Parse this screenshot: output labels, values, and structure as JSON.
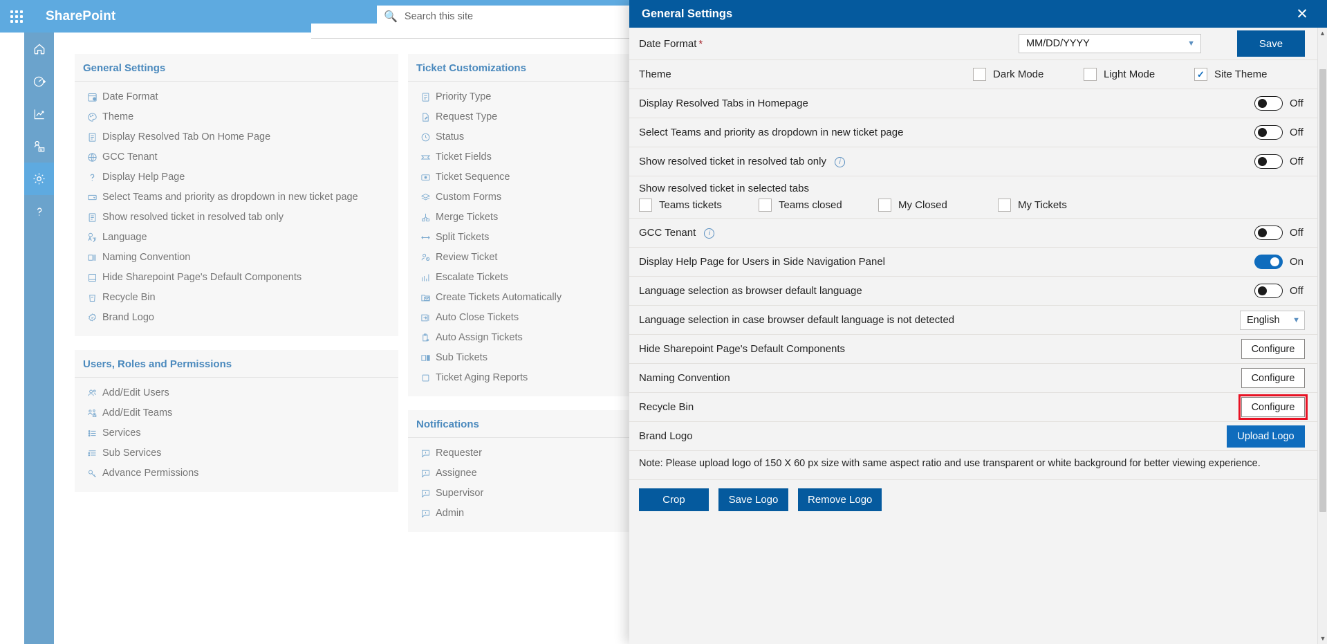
{
  "suitebar": {
    "waffle_label": "app-launcher",
    "title": "SharePoint",
    "search_placeholder": "Search this site"
  },
  "rail": {
    "items": [
      {
        "name": "home",
        "label": "Home"
      },
      {
        "name": "dashboard",
        "label": "Dashboard"
      },
      {
        "name": "reports",
        "label": "Reports"
      },
      {
        "name": "teams",
        "label": "Teams"
      },
      {
        "name": "settings",
        "label": "Settings",
        "active": true
      },
      {
        "name": "help",
        "label": "Help"
      }
    ]
  },
  "groups": [
    {
      "title": "General Settings",
      "items": [
        {
          "icon": "calendar-clock-icon",
          "label": "Date Format"
        },
        {
          "icon": "palette-icon",
          "label": "Theme"
        },
        {
          "icon": "document-icon",
          "label": "Display Resolved Tab On Home Page"
        },
        {
          "icon": "globe-icon",
          "label": "GCC Tenant"
        },
        {
          "icon": "question-icon",
          "label": "Display Help Page"
        },
        {
          "icon": "dropdown-box-icon",
          "label": "Select Teams and priority as dropdown in new ticket page"
        },
        {
          "icon": "document-icon",
          "label": "Show resolved ticket in resolved tab only"
        },
        {
          "icon": "translate-icon",
          "label": "Language"
        },
        {
          "icon": "naming-icon",
          "label": "Naming Convention"
        },
        {
          "icon": "page-icon",
          "label": "Hide Sharepoint Page's Default Components"
        },
        {
          "icon": "recycle-bin-icon",
          "label": "Recycle Bin"
        },
        {
          "icon": "badge-icon",
          "label": "Brand Logo"
        }
      ]
    },
    {
      "title": "Users, Roles and Permissions",
      "items": [
        {
          "icon": "people-icon",
          "label": "Add/Edit Users"
        },
        {
          "icon": "team-icon",
          "label": "Add/Edit Teams"
        },
        {
          "icon": "list-icon",
          "label": "Services"
        },
        {
          "icon": "sublist-icon",
          "label": "Sub Services"
        },
        {
          "icon": "key-icon",
          "label": "Advance Permissions"
        }
      ]
    }
  ],
  "groups2": [
    {
      "title": "Ticket Customizations",
      "items": [
        {
          "icon": "priority-list-icon",
          "label": "Priority Type"
        },
        {
          "icon": "request-edit-icon",
          "label": "Request Type"
        },
        {
          "icon": "clock-check-icon",
          "label": "Status"
        },
        {
          "icon": "ticket-icon",
          "label": "Ticket Fields"
        },
        {
          "icon": "sequence-icon",
          "label": "Ticket Sequence"
        },
        {
          "icon": "layers-icon",
          "label": "Custom Forms"
        },
        {
          "icon": "merge-icon",
          "label": "Merge Tickets"
        },
        {
          "icon": "split-icon",
          "label": "Split Tickets"
        },
        {
          "icon": "review-people-icon",
          "label": "Review Ticket"
        },
        {
          "icon": "chart-up-icon",
          "label": "Escalate Tickets"
        },
        {
          "icon": "mail-folder-icon",
          "label": "Create Tickets Automatically"
        },
        {
          "icon": "auto-close-icon",
          "label": "Auto Close Tickets"
        },
        {
          "icon": "clipboard-arrow-icon",
          "label": "Auto Assign Tickets"
        },
        {
          "icon": "panels-icon",
          "label": "Sub Tickets"
        },
        {
          "icon": "square-icon",
          "label": "Ticket Aging Reports"
        }
      ]
    },
    {
      "title": "Notifications",
      "items": [
        {
          "icon": "comment-icon",
          "label": "Requester"
        },
        {
          "icon": "comment-icon",
          "label": "Assignee"
        },
        {
          "icon": "comment-icon",
          "label": "Supervisor"
        },
        {
          "icon": "comment-icon",
          "label": "Admin"
        }
      ]
    }
  ],
  "panel": {
    "title": "General Settings",
    "close_label": "close-icon",
    "save_label": "Save",
    "date_format": {
      "label": "Date Format",
      "required_marker": "*",
      "value": "MM/DD/YYYY"
    },
    "theme": {
      "label": "Theme",
      "options": [
        {
          "label": "Dark Mode",
          "checked": false
        },
        {
          "label": "Light Mode",
          "checked": false
        },
        {
          "label": "Site Theme",
          "checked": true
        }
      ]
    },
    "toggle_rows": [
      {
        "label": "Display Resolved Tabs in Homepage",
        "state": "Off",
        "on": false,
        "info": false
      },
      {
        "label": "Select Teams and priority as dropdown in new ticket page",
        "state": "Off",
        "on": false,
        "info": false
      },
      {
        "label": "Show resolved ticket in resolved tab only",
        "state": "Off",
        "on": false,
        "info": true
      }
    ],
    "resolved_tabs": {
      "label": "Show resolved ticket in selected tabs",
      "options": [
        {
          "label": "Teams tickets",
          "checked": false
        },
        {
          "label": "Teams closed",
          "checked": false
        },
        {
          "label": "My Closed",
          "checked": false
        },
        {
          "label": "My Tickets",
          "checked": false
        }
      ]
    },
    "toggle_rows2": [
      {
        "label": "GCC Tenant",
        "state": "Off",
        "on": false,
        "info": true
      },
      {
        "label": "Display Help Page for Users in Side Navigation Panel",
        "state": "On",
        "on": true,
        "info": false
      },
      {
        "label": "Language selection as browser default language",
        "state": "Off",
        "on": false,
        "info": false
      }
    ],
    "language_row": {
      "label": "Language selection in case browser default language is not detected",
      "value": "English"
    },
    "configure_rows": [
      {
        "label": "Hide Sharepoint Page's Default Components",
        "button": "Configure",
        "highlight": false
      },
      {
        "label": "Naming Convention",
        "button": "Configure",
        "highlight": false
      },
      {
        "label": "Recycle Bin",
        "button": "Configure",
        "highlight": true
      }
    ],
    "brand_logo": {
      "label": "Brand Logo",
      "upload_label": "Upload Logo",
      "note": "Note: Please upload logo of 150 X 60 px size with same aspect ratio and use transparent or white background for better viewing experience.",
      "buttons": [
        "Crop",
        "Save Logo",
        "Remove Logo"
      ]
    }
  },
  "colors": {
    "suitebar": "#5eaae0",
    "panel_header": "#055a9e",
    "accent": "#0f6cbd",
    "highlight": "#e81123",
    "group_title": "#4a89bd"
  }
}
